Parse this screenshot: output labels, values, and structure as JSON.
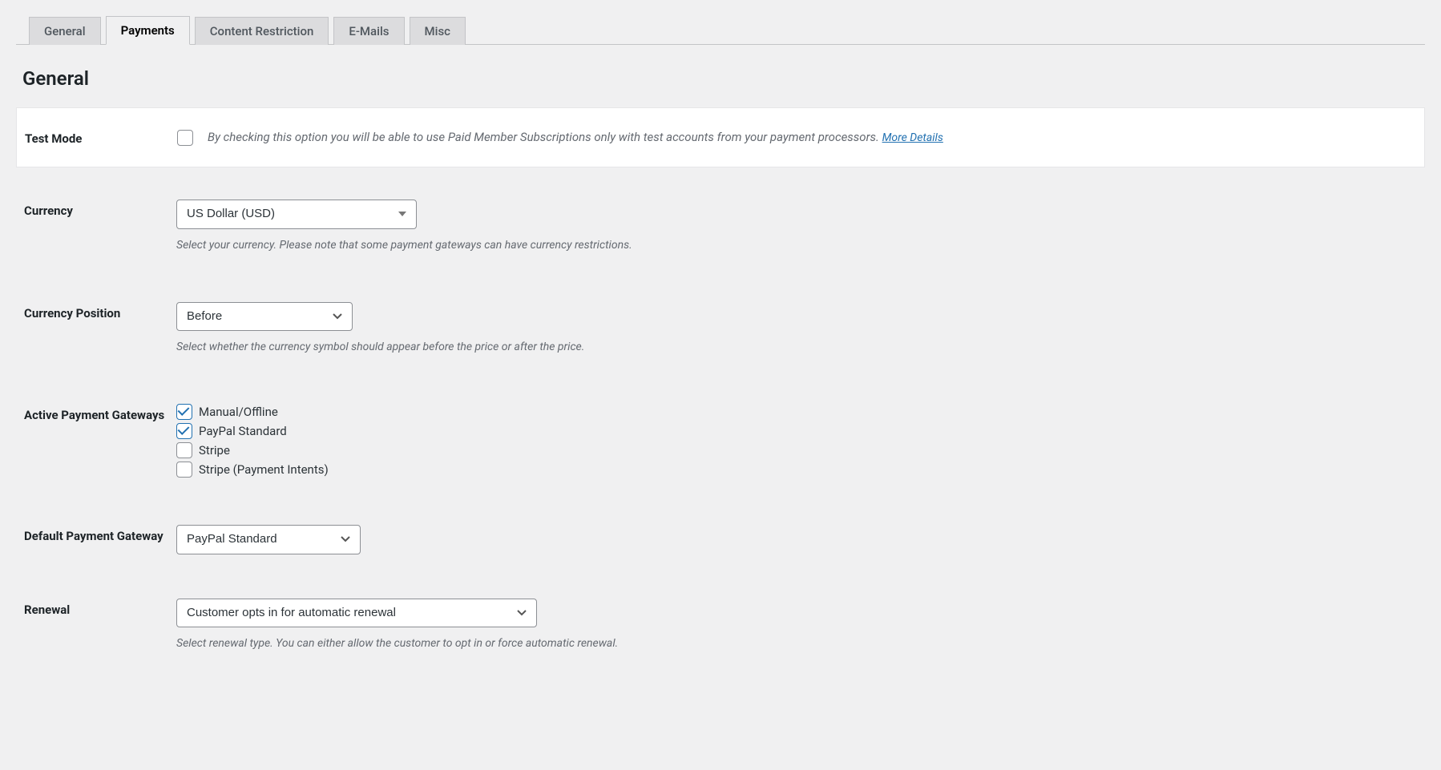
{
  "tabs": {
    "general": "General",
    "payments": "Payments",
    "content_restriction": "Content Restriction",
    "emails": "E-Mails",
    "misc": "Misc"
  },
  "page_title": "General",
  "test_mode": {
    "label": "Test Mode",
    "description": "By checking this option you will be able to use Paid Member Subscriptions only with test accounts from your payment processors. ",
    "more_details": "More Details",
    "checked": false
  },
  "currency": {
    "label": "Currency",
    "value": "US Dollar (USD)",
    "description": "Select your currency. Please note that some payment gateways can have currency restrictions."
  },
  "currency_position": {
    "label": "Currency Position",
    "value": "Before",
    "description": "Select whether the currency symbol should appear before the price or after the price."
  },
  "active_gateways": {
    "label": "Active Payment Gateways",
    "options": [
      {
        "label": "Manual/Offline",
        "checked": true
      },
      {
        "label": "PayPal Standard",
        "checked": true
      },
      {
        "label": "Stripe",
        "checked": false
      },
      {
        "label": "Stripe (Payment Intents)",
        "checked": false
      }
    ]
  },
  "default_gateway": {
    "label": "Default Payment Gateway",
    "value": "PayPal Standard"
  },
  "renewal": {
    "label": "Renewal",
    "value": "Customer opts in for automatic renewal",
    "description": "Select renewal type. You can either allow the customer to opt in or force automatic renewal."
  }
}
